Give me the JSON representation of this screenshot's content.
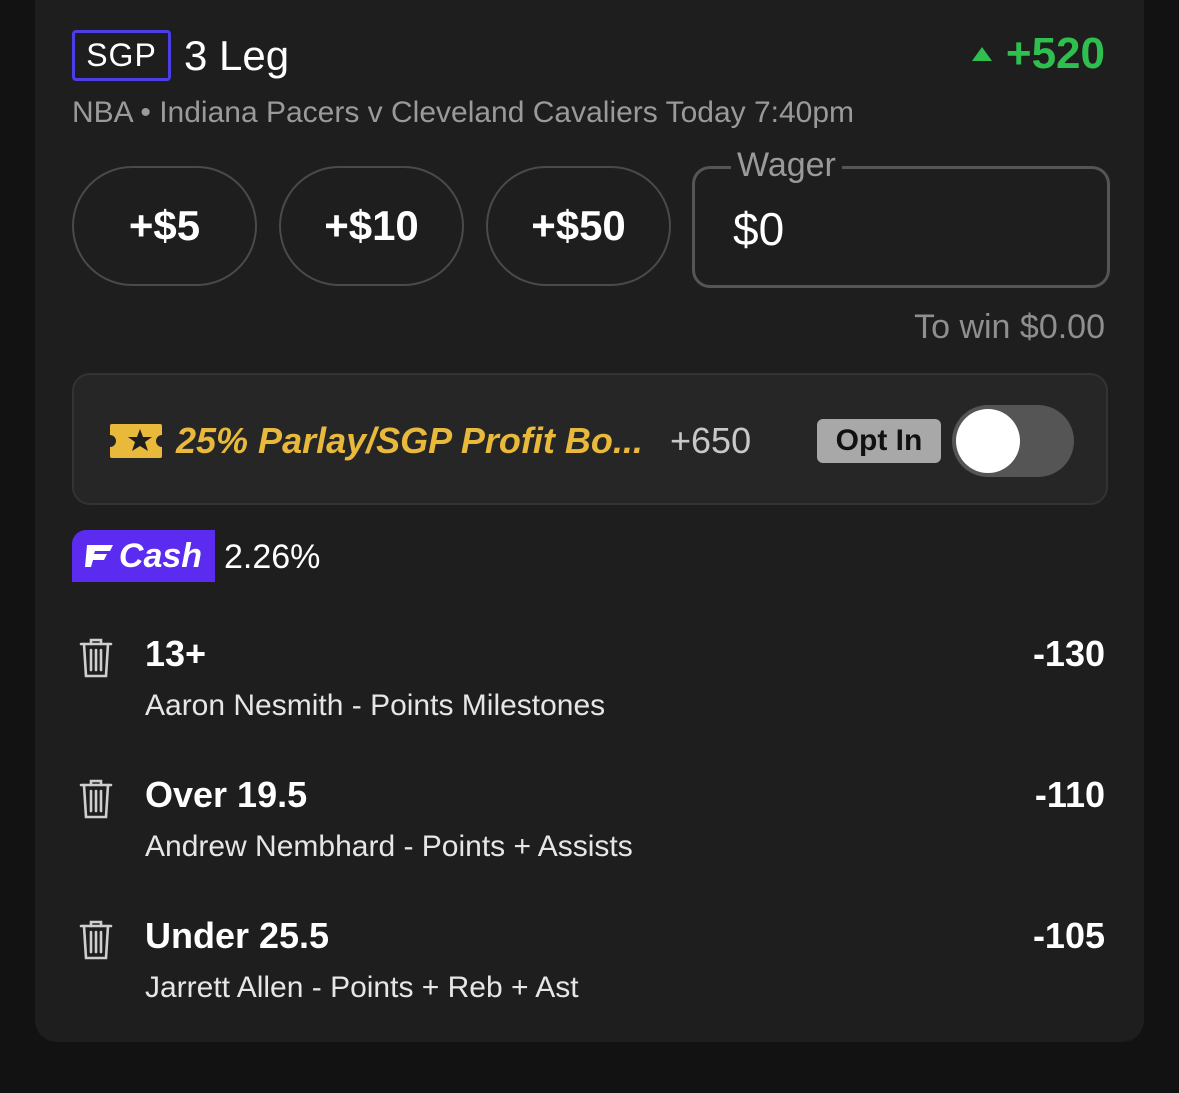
{
  "header": {
    "badge": "SGP",
    "title": "3 Leg",
    "total_odds": "+520",
    "subtitle": "NBA • Indiana Pacers v Cleveland Cavaliers Today 7:40pm"
  },
  "wager": {
    "quick_amounts": [
      "+$5",
      "+$10",
      "+$50"
    ],
    "label": "Wager",
    "value": "$0",
    "to_win": "To win $0.00"
  },
  "boost": {
    "label": "25% Parlay/SGP Profit Bo...",
    "odds": "+650",
    "opt_in_label": "Opt In",
    "toggle_on": false
  },
  "cash": {
    "badge": "Cash",
    "percent": "2.26%"
  },
  "legs": [
    {
      "selection": "13+",
      "description": "Aaron Nesmith - Points Milestones",
      "odds": "-130"
    },
    {
      "selection": "Over 19.5",
      "description": "Andrew Nembhard - Points + Assists",
      "odds": "-110"
    },
    {
      "selection": "Under 25.5",
      "description": "Jarrett Allen - Points + Reb + Ast",
      "odds": "-105"
    }
  ],
  "colors": {
    "accent_green": "#2fbf4f",
    "sgp_border": "#4a3ee6",
    "boost_gold": "#e8b93a",
    "cash_purple": "#5b2bf0"
  }
}
